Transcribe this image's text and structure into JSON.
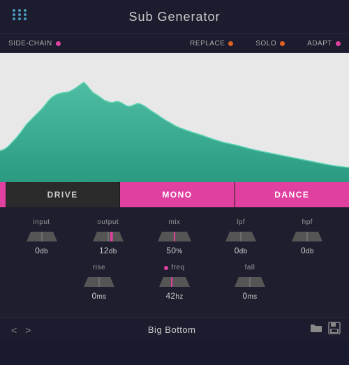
{
  "header": {
    "title": "Sub Generator",
    "logo_symbol": "⠿"
  },
  "topbar": {
    "sidechain_label": "SIDE-CHAIN",
    "replace_label": "REPLACE",
    "solo_label": "SOLO",
    "adapt_label": "ADAPT"
  },
  "mode_buttons": {
    "left_accent": "",
    "drive_label": "DRIVE",
    "mono_label": "MONO",
    "dance_label": "DANCE"
  },
  "controls": {
    "row1": [
      {
        "id": "input",
        "label": "input",
        "value": "0",
        "unit": "db",
        "fader_type": "flat"
      },
      {
        "id": "output",
        "label": "output",
        "value": "12",
        "unit": "db",
        "fader_type": "center"
      },
      {
        "id": "mix",
        "label": "mix",
        "value": "50",
        "unit": "%",
        "fader_type": "wide"
      },
      {
        "id": "lpf",
        "label": "lpf",
        "value": "0",
        "unit": "db",
        "fader_type": "flat"
      },
      {
        "id": "hpf",
        "label": "hpf",
        "value": "0",
        "unit": "db",
        "fader_type": "flat"
      }
    ],
    "row2": [
      {
        "id": "rise",
        "label": "rise",
        "value": "0",
        "unit": "ms",
        "fader_type": "flat",
        "has_dot": false
      },
      {
        "id": "freq",
        "label": "freq",
        "value": "42",
        "unit": "hz",
        "fader_type": "center",
        "has_dot": true
      },
      {
        "id": "fall",
        "label": "fall",
        "value": "0",
        "unit": "ms",
        "fader_type": "flat",
        "has_dot": false
      }
    ]
  },
  "footer": {
    "prev_label": "<",
    "next_label": ">",
    "preset_name": "Big Bottom",
    "folder_icon": "🗁",
    "save_icon": "💾"
  }
}
